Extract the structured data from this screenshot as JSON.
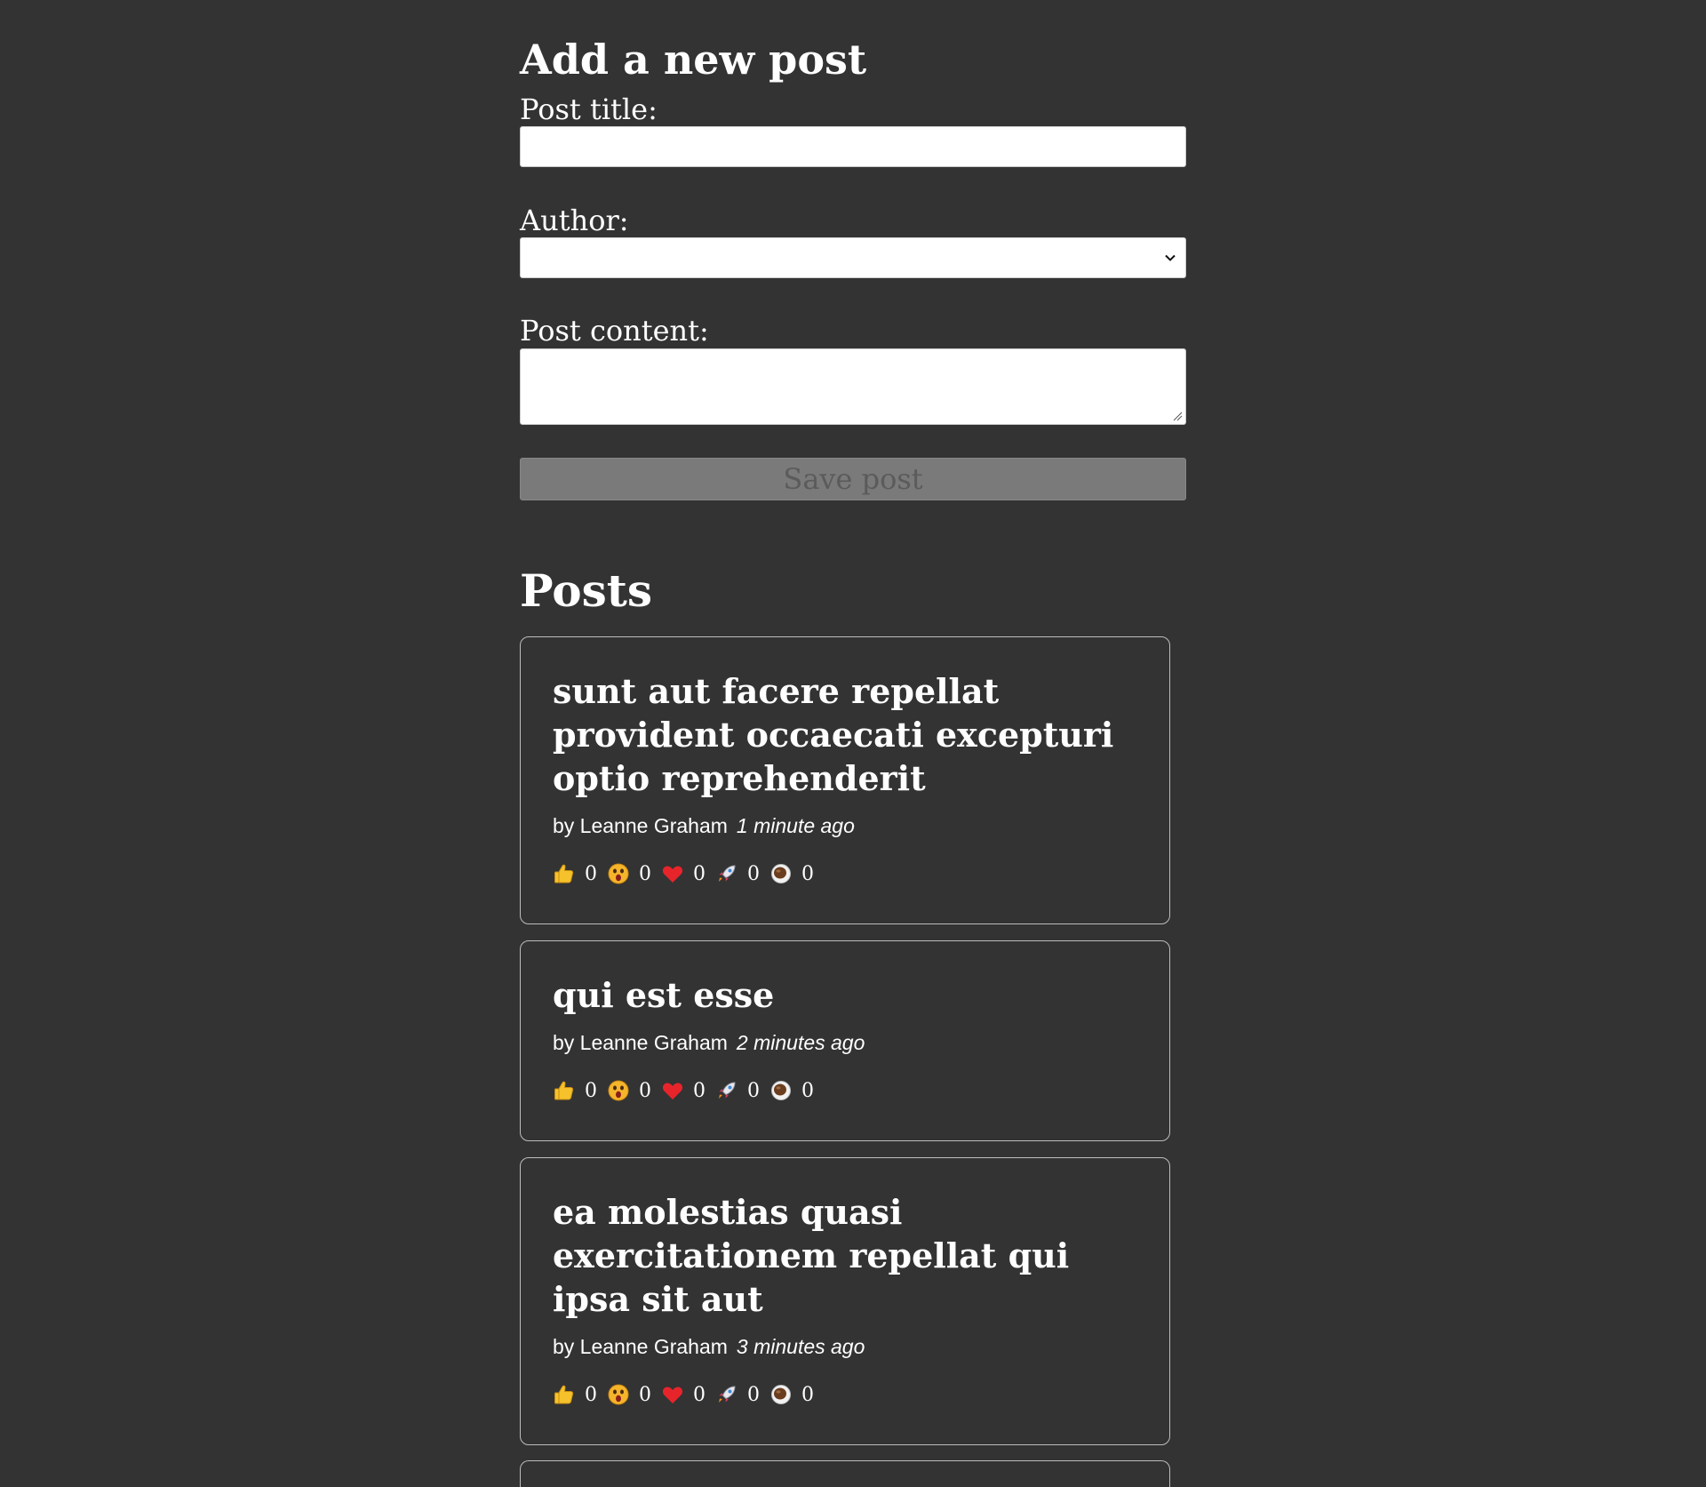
{
  "form": {
    "heading": "Add a new post",
    "title_label": "Post title:",
    "title_value": "",
    "author_label": "Author:",
    "author_selected": "",
    "content_label": "Post content:",
    "content_value": "",
    "save_label": "Save post"
  },
  "posts_heading": "Posts",
  "posts": [
    {
      "title": "sunt aut facere repellat provident occaecati excepturi optio reprehenderit",
      "author": "by Leanne Graham",
      "time": "1 minute ago",
      "reactions": [
        "0",
        "0",
        "0",
        "0",
        "0"
      ]
    },
    {
      "title": "qui est esse",
      "author": "by Leanne Graham",
      "time": "2 minutes ago",
      "reactions": [
        "0",
        "0",
        "0",
        "0",
        "0"
      ]
    },
    {
      "title": "ea molestias quasi exercitationem repellat qui ipsa sit aut",
      "author": "by Leanne Graham",
      "time": "3 minutes ago",
      "reactions": [
        "0",
        "0",
        "0",
        "0",
        "0"
      ]
    }
  ],
  "reaction_icons": [
    "thumbs-up-icon",
    "surprised-face-icon",
    "heart-icon",
    "rocket-icon",
    "coffee-icon"
  ],
  "colors": {
    "background": "#333333",
    "text": "#ffffff",
    "disabled_button": "#7a7a7a",
    "heart": "#e8242b",
    "thumb": "#f5c22b"
  }
}
